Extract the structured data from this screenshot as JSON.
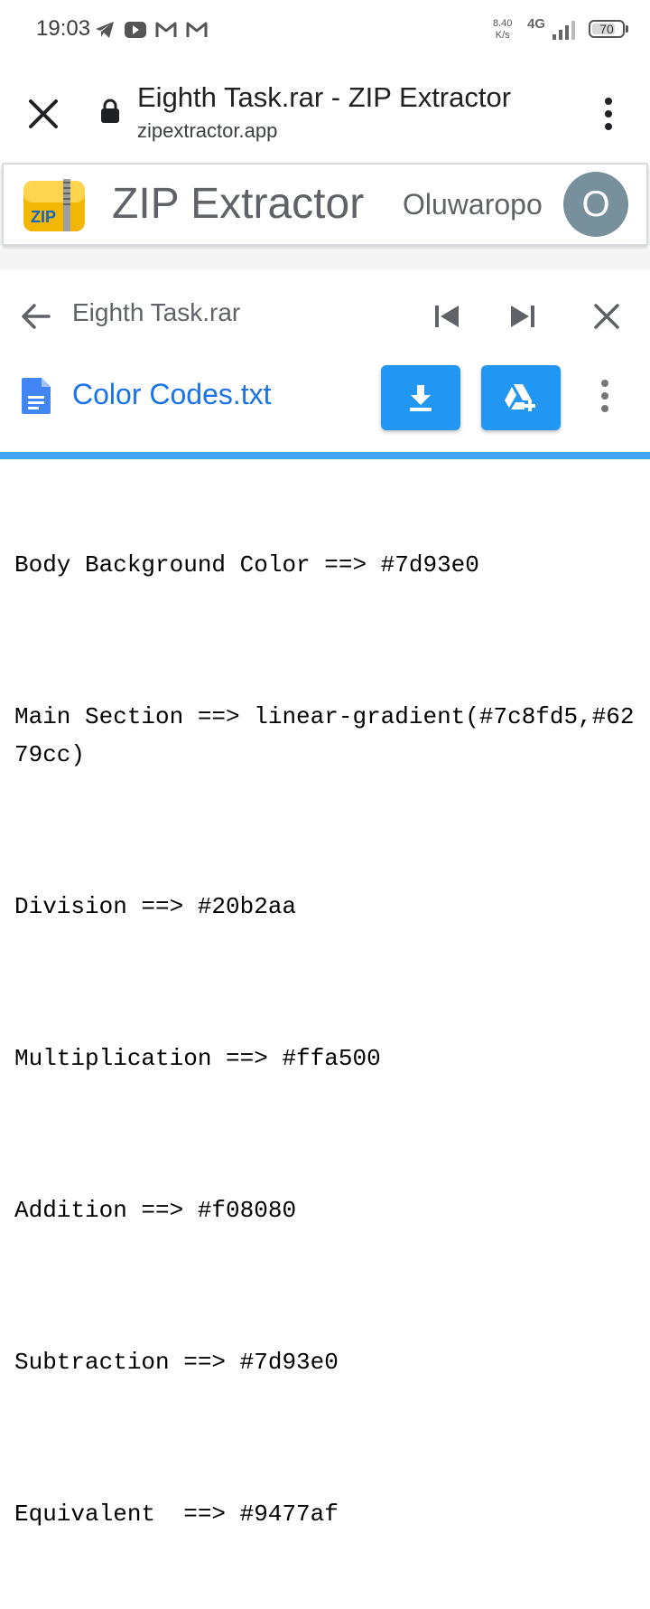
{
  "status_bar": {
    "time": "19:03",
    "network_speed": "8.40",
    "network_unit": "K/s",
    "network_type": "4G",
    "battery": "70",
    "icons": [
      "telegram-icon",
      "youtube-icon",
      "gmail-icon",
      "gmail-icon"
    ]
  },
  "browser": {
    "page_title": "Eighth Task.rar - ZIP Extractor",
    "url": "zipextractor.app"
  },
  "app_header": {
    "title": "ZIP Extractor",
    "logo_text": "ZIP",
    "user_name": "Oluwaropo",
    "avatar_letter": "O"
  },
  "file_toolbar": {
    "archive_name": "Eighth Task.rar",
    "file_name": "Color Codes.txt"
  },
  "file_content": {
    "lines": [
      "Body Background Color ==> #7d93e0",
      "Main Section ==> linear-gradient(#7c8fd5,#6279cc)",
      "Division ==> #20b2aa",
      "Multiplication ==> #ffa500",
      "Addition ==> #f08080",
      "Subtraction ==> #7d93e0",
      "Equivalent  ==> #9477af"
    ]
  },
  "colors": {
    "accent_blue": "#2196f3",
    "link_blue": "#1a73e8",
    "avatar_bg": "#78909c",
    "progress": "#42a5f5"
  }
}
